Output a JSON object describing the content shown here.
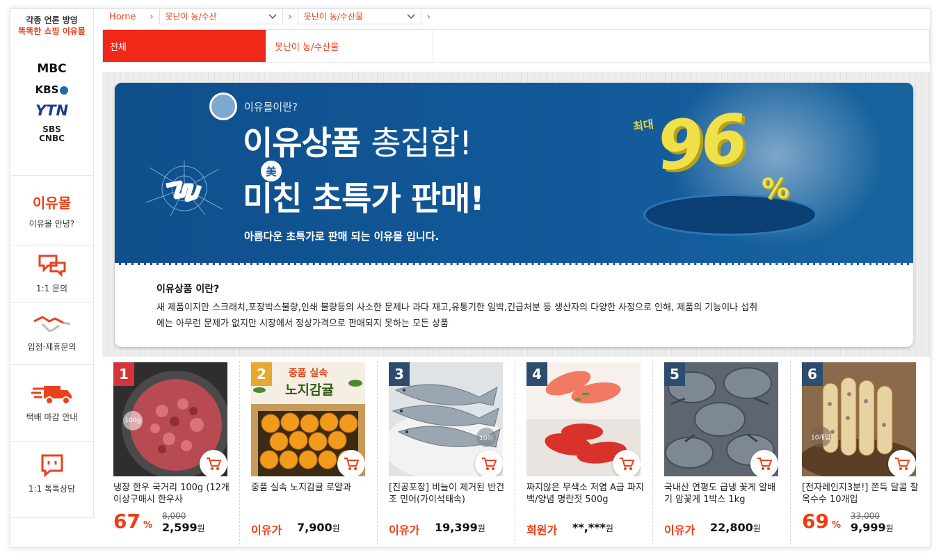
{
  "sidebar": {
    "head_line1": "각종 언론 방영",
    "head_line2": "똑똑한 쇼핑 이유몰",
    "media": {
      "mbc": "MBC",
      "kbs": "KBS",
      "ytn": "YTN",
      "sbs_line1": "SBS",
      "sbs_line2": "CNBC"
    },
    "items": [
      {
        "logo": "이유몰",
        "label": "이유몰 안녕?"
      },
      {
        "label": "1:1 문의"
      },
      {
        "label": "입점·제휴문의"
      },
      {
        "label": "택배 마감 안내"
      },
      {
        "label": "1:1 톡톡상담"
      }
    ]
  },
  "breadcrumb": {
    "home": "Home",
    "select1": "못난이 농/수산",
    "select2": "못난이 농/수산물"
  },
  "tabs": [
    {
      "label": "전체",
      "active": true
    },
    {
      "label": "못난이 농/수산물",
      "active": false
    }
  ],
  "banner": {
    "question": "이유몰이란?",
    "title_bold": "이유상품",
    "title_rest": "총집합!",
    "mi_badge": "美",
    "line2": "미친 초특가 판매!",
    "sub": "아름다운 초특가로 판매 되는 이유몰 입니다.",
    "max_label": "최대",
    "percent": "96",
    "percent_sign": "%",
    "desc_heading": "이유상품 이란?",
    "desc_line1": "새 제품이지만 스크래치,포장박스불량,인쇄 불량등의 사소한 문제나 과다 재고,유통기한 임박,긴급처분 등 생산자의 다양한 사정으로 인해, 제품의 기능이나 섭취",
    "desc_line2": "에는 아무런 문제가 없지만 시장에서 정상가격으로 판매되지 못하는 모든 상품"
  },
  "products": [
    {
      "rank": "1",
      "rank_color": "#d2353c",
      "title": "냉장 한우 국거리 100g (12개이상구매시 한우사",
      "discount": "67",
      "pct": "%",
      "orig": "8,000",
      "price": "2,599",
      "won": "원",
      "badge": "100g",
      "img": "beef"
    },
    {
      "rank": "2",
      "rank_color": "#e7a830",
      "title": "중품 실속 노지감귤 로얄과",
      "label": "이유가",
      "price": "7,900",
      "won": "원",
      "img": "tangerine",
      "img_text1": "중품 실속",
      "img_text2": "노지감귤"
    },
    {
      "rank": "3",
      "rank_color": "#2c4d6e",
      "title": "[진공포장] 비늘이 제거된 반건조 민어(가이석태속)",
      "label": "이유가",
      "price": "19,399",
      "won": "원",
      "badge": "10미",
      "img": "fish"
    },
    {
      "rank": "4",
      "rank_color": "#2c4d6e",
      "title": "짜지않은 무색소 저염 A급 파지 백/양념 명란젓 500g",
      "label": "회원가",
      "price": "**,***",
      "won": "원",
      "img": "roe"
    },
    {
      "rank": "5",
      "rank_color": "#2c4d6e",
      "title": "국내산 연평도 급냉 꽃게 알배기 암꽃게 1박스 1kg",
      "label": "이유가",
      "price": "22,800",
      "won": "원",
      "img": "crab"
    },
    {
      "rank": "6",
      "rank_color": "#2c4d6e",
      "title": "[전자레인지3분!] 쫀득 달콤 찰옥수수 10개입",
      "discount": "69",
      "pct": "%",
      "orig": "33,000",
      "price": "9,999",
      "won": "원",
      "badge": "10개입",
      "img": "corn"
    }
  ]
}
